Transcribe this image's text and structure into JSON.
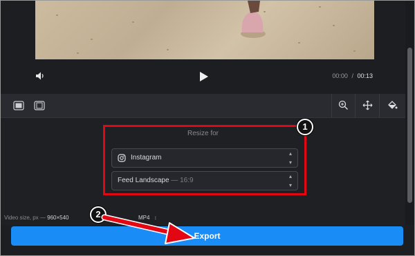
{
  "player": {
    "current_time": "00:00",
    "separator": "/",
    "duration": "00:13"
  },
  "panel": {
    "title": "Resize for",
    "platform_select": {
      "value": "Instagram",
      "icon": "instagram-icon"
    },
    "format_select": {
      "value": "Feed Landscape",
      "ratio": "— 16:9"
    }
  },
  "footer_info": {
    "video_size_label": "Video size, px —",
    "video_size_value": "960×540",
    "format_value": "MP4"
  },
  "export_button": {
    "label": "Export"
  },
  "annotations": {
    "callout_1": "1",
    "callout_2": "2",
    "highlight_color": "#e30613"
  },
  "colors": {
    "accent": "#1a8cf5",
    "background": "#1d1e22"
  }
}
